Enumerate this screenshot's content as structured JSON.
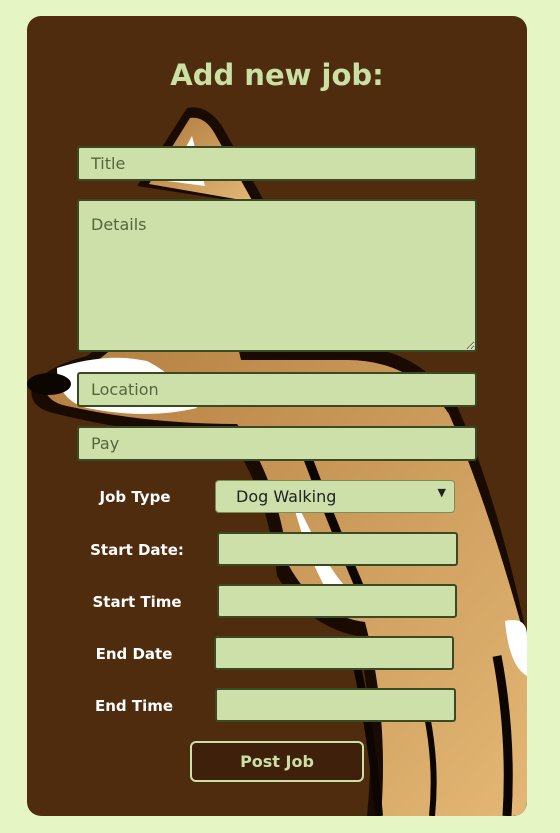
{
  "form": {
    "heading": "Add new job:",
    "title_placeholder": "Title",
    "details_placeholder": "Details",
    "location_placeholder": "Location",
    "pay_placeholder": "Pay",
    "job_type_label": "Job Type",
    "job_type_selected": "Dog Walking",
    "start_date_label": "Start Date:",
    "start_time_label": "Start Time",
    "end_date_label": "End Date",
    "end_time_label": "End Time",
    "submit_label": "Post Job"
  },
  "colors": {
    "page_bg": "#e6f5c4",
    "card_bg": "#4f2c0e",
    "field_bg": "#cde0aa",
    "accent_text": "#cbe0a5",
    "button_bg": "#3f200b"
  }
}
